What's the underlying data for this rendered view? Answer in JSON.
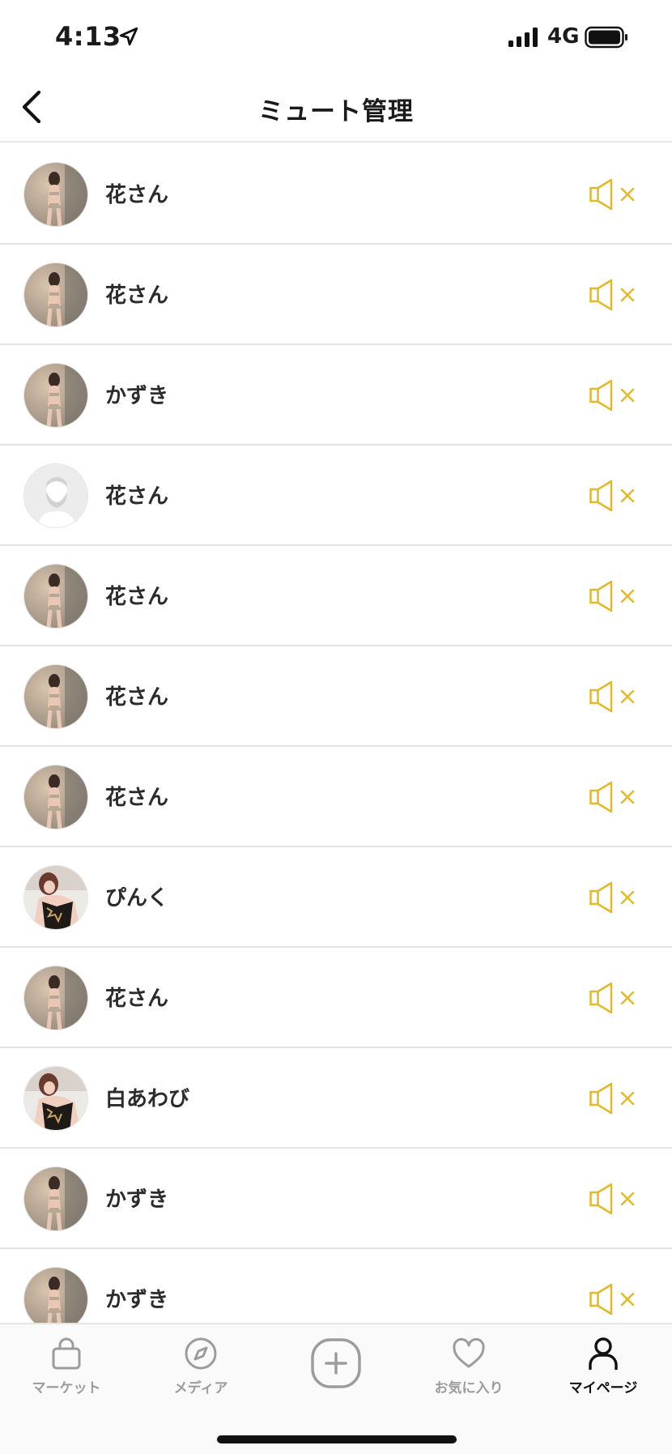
{
  "status_bar": {
    "time": "4:13",
    "network": "4G",
    "icons": [
      "location-arrow-icon",
      "signal-icon",
      "battery-icon"
    ]
  },
  "nav": {
    "title": "ミュート管理",
    "back_icon": "chevron-left-icon"
  },
  "accent_color": "#e3b929",
  "muted_users": [
    {
      "name": "花さん",
      "avatar": "photo-a"
    },
    {
      "name": "花さん",
      "avatar": "photo-a"
    },
    {
      "name": "かずき",
      "avatar": "photo-a"
    },
    {
      "name": "花さん",
      "avatar": "default"
    },
    {
      "name": "花さん",
      "avatar": "photo-a"
    },
    {
      "name": "花さん",
      "avatar": "photo-a"
    },
    {
      "name": "花さん",
      "avatar": "photo-a"
    },
    {
      "name": "ぴんく",
      "avatar": "photo-b"
    },
    {
      "name": "花さん",
      "avatar": "photo-a"
    },
    {
      "name": "白あわび",
      "avatar": "photo-b"
    },
    {
      "name": "かずき",
      "avatar": "photo-a"
    },
    {
      "name": "かずき",
      "avatar": "photo-a"
    }
  ],
  "tab_bar": {
    "tabs": [
      {
        "label": "マーケット",
        "icon": "shopping-bag-icon",
        "active": false
      },
      {
        "label": "メディア",
        "icon": "compass-icon",
        "active": false
      },
      {
        "label": "",
        "icon": "plus-circle-icon",
        "active": false
      },
      {
        "label": "お気に入り",
        "icon": "heart-icon",
        "active": false
      },
      {
        "label": "マイページ",
        "icon": "person-icon",
        "active": true
      }
    ]
  }
}
